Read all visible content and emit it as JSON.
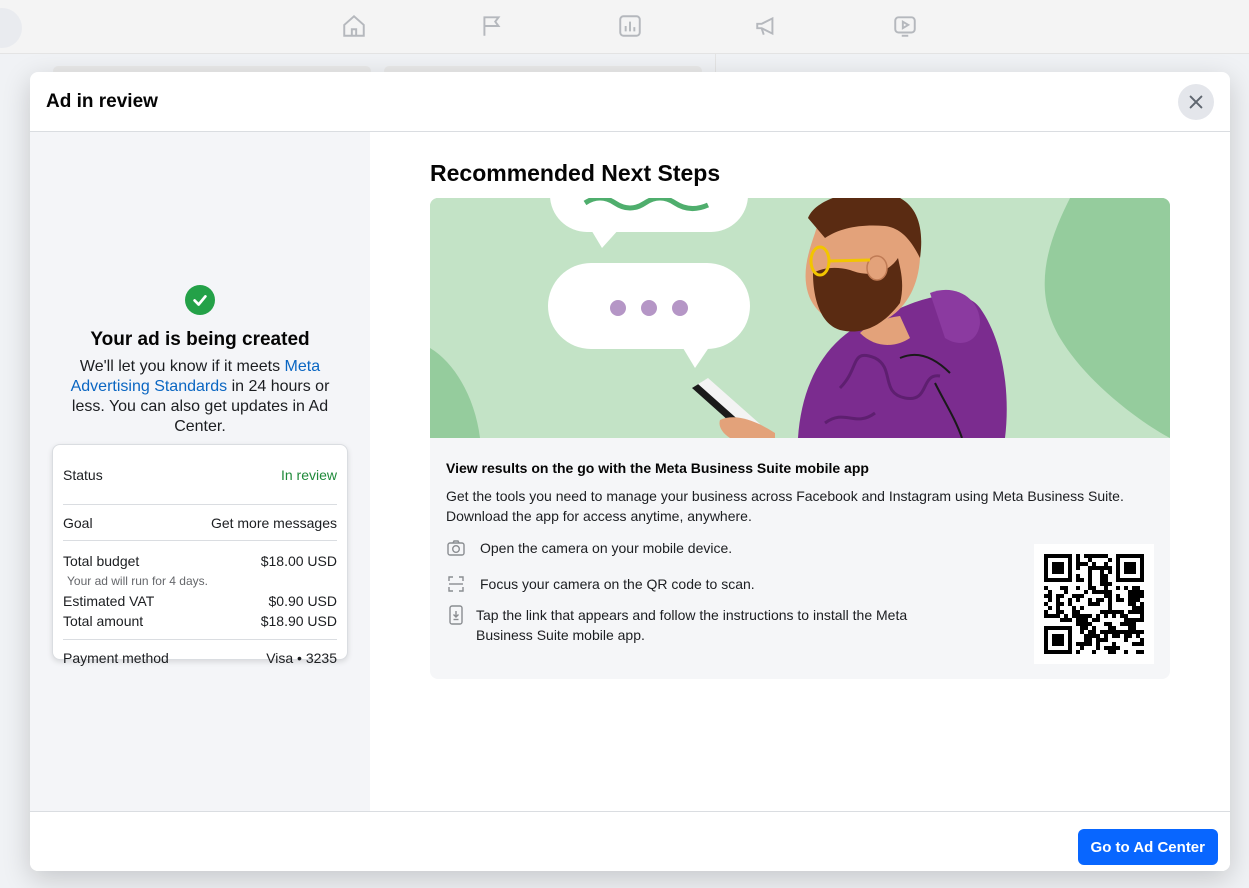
{
  "background": {
    "nav_icons": [
      "home-icon",
      "flag-icon",
      "insights-icon",
      "megaphone-icon",
      "video-icon"
    ]
  },
  "modal": {
    "title": "Ad in review",
    "close_icon": "close-icon"
  },
  "left": {
    "check_icon": "check-circle-icon",
    "heading": "Your ad is being created",
    "desc_before": "We'll let you know if it meets ",
    "desc_link": "Meta Advertising Standards",
    "desc_after": " in 24 hours or less. You can also get updates in Ad Center.",
    "summary": {
      "status_label": "Status",
      "status_value": "In review",
      "goal_label": "Goal",
      "goal_value": "Get more messages",
      "budget_label": "Total budget",
      "budget_value": "$18.00 USD",
      "budget_note": "Your ad will run for 4 days.",
      "vat_label": "Estimated VAT",
      "vat_value": "$0.90 USD",
      "total_label": "Total amount",
      "total_value": "$18.90 USD",
      "payment_label": "Payment method",
      "payment_value": "Visa • 3235"
    }
  },
  "right": {
    "heading": "Recommended Next Steps",
    "info_title": "View results on the go with the Meta Business Suite mobile app",
    "info_desc": "Get the tools you need to manage your business across Facebook and Instagram using Meta Business Suite. Download the app for access anytime, anywhere.",
    "steps": [
      {
        "icon": "camera-icon",
        "text": "Open the camera on your mobile device."
      },
      {
        "icon": "scan-frame-icon",
        "text": "Focus your camera on the QR code to scan."
      },
      {
        "icon": "phone-download-icon",
        "text": "Tap the link that appears and follow the instructions to install the Meta Business Suite mobile app."
      }
    ],
    "qr_icon": "qr-code-icon"
  },
  "footer": {
    "primary_button": "Go to Ad Center"
  },
  "colors": {
    "primary": "#0866ff",
    "link": "#0a66c2",
    "success": "#24a148",
    "status_green": "#1f8a3a",
    "hero_bg": "#c3e3c6",
    "hoodie": "#7b2c8f"
  }
}
